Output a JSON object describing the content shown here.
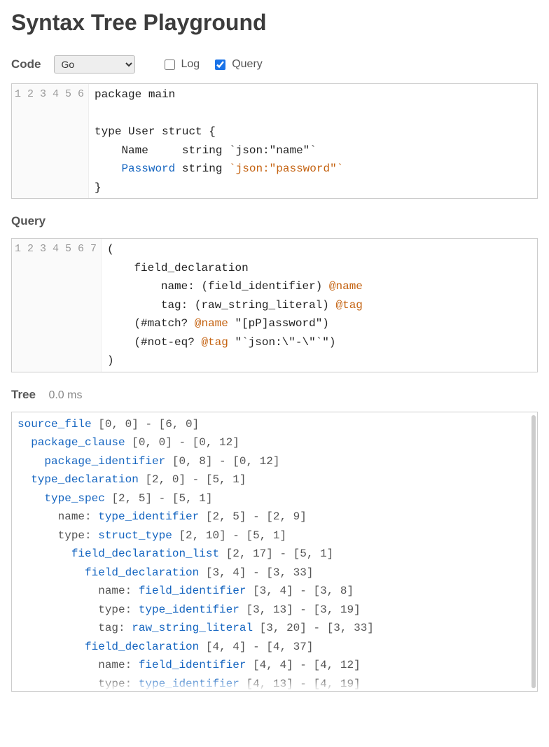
{
  "title": "Syntax Tree Playground",
  "controls": {
    "code_label": "Code",
    "language_selected": "Go",
    "log_label": "Log",
    "log_checked": false,
    "query_label": "Query",
    "query_checked": true
  },
  "code_editor": {
    "lines": [
      [
        {
          "t": "package main",
          "c": "tok-kw"
        }
      ],
      [
        {
          "t": "",
          "c": ""
        }
      ],
      [
        {
          "t": "type User struct {",
          "c": "tok-kw"
        }
      ],
      [
        {
          "t": "    Name     string ",
          "c": "tok-kw"
        },
        {
          "t": "`json:\"name\"`",
          "c": "tok-kw"
        }
      ],
      [
        {
          "t": "    ",
          "c": ""
        },
        {
          "t": "Password",
          "c": "tok-hl"
        },
        {
          "t": " string ",
          "c": "tok-kw"
        },
        {
          "t": "`json:\"password\"`",
          "c": "tok-str"
        }
      ],
      [
        {
          "t": "}",
          "c": "tok-kw"
        }
      ]
    ]
  },
  "query_section_label": "Query",
  "query_editor": {
    "lines": [
      [
        {
          "t": "(",
          "c": ""
        }
      ],
      [
        {
          "t": "    field_declaration",
          "c": ""
        }
      ],
      [
        {
          "t": "        name: (field_identifier) ",
          "c": ""
        },
        {
          "t": "@name",
          "c": "tok-cap"
        }
      ],
      [
        {
          "t": "        tag: (raw_string_literal) ",
          "c": ""
        },
        {
          "t": "@tag",
          "c": "tok-cap"
        }
      ],
      [
        {
          "t": "    (#match? ",
          "c": ""
        },
        {
          "t": "@name",
          "c": "tok-cap"
        },
        {
          "t": " \"[pP]assword\")",
          "c": ""
        }
      ],
      [
        {
          "t": "    (#not-eq? ",
          "c": ""
        },
        {
          "t": "@tag",
          "c": "tok-cap"
        },
        {
          "t": " \"`json:\\\"-\\\"`\")",
          "c": ""
        }
      ],
      [
        {
          "t": ")",
          "c": ""
        }
      ]
    ]
  },
  "tree_section_label": "Tree",
  "timing": "0.0 ms",
  "tree": [
    {
      "indent": 0,
      "field": "",
      "node": "source_file",
      "range": "[0, 0] - [6, 0]"
    },
    {
      "indent": 1,
      "field": "",
      "node": "package_clause",
      "range": "[0, 0] - [0, 12]"
    },
    {
      "indent": 2,
      "field": "",
      "node": "package_identifier",
      "range": "[0, 8] - [0, 12]"
    },
    {
      "indent": 1,
      "field": "",
      "node": "type_declaration",
      "range": "[2, 0] - [5, 1]"
    },
    {
      "indent": 2,
      "field": "",
      "node": "type_spec",
      "range": "[2, 5] - [5, 1]"
    },
    {
      "indent": 3,
      "field": "name: ",
      "node": "type_identifier",
      "range": "[2, 5] - [2, 9]"
    },
    {
      "indent": 3,
      "field": "type: ",
      "node": "struct_type",
      "range": "[2, 10] - [5, 1]"
    },
    {
      "indent": 4,
      "field": "",
      "node": "field_declaration_list",
      "range": "[2, 17] - [5, 1]"
    },
    {
      "indent": 5,
      "field": "",
      "node": "field_declaration",
      "range": "[3, 4] - [3, 33]"
    },
    {
      "indent": 6,
      "field": "name: ",
      "node": "field_identifier",
      "range": "[3, 4] - [3, 8]"
    },
    {
      "indent": 6,
      "field": "type: ",
      "node": "type_identifier",
      "range": "[3, 13] - [3, 19]"
    },
    {
      "indent": 6,
      "field": "tag: ",
      "node": "raw_string_literal",
      "range": "[3, 20] - [3, 33]"
    },
    {
      "indent": 5,
      "field": "",
      "node": "field_declaration",
      "range": "[4, 4] - [4, 37]"
    },
    {
      "indent": 6,
      "field": "name: ",
      "node": "field_identifier",
      "range": "[4, 4] - [4, 12]"
    },
    {
      "indent": 6,
      "field": "type: ",
      "node": "type_identifier",
      "range": "[4, 13] - [4, 19]"
    }
  ]
}
